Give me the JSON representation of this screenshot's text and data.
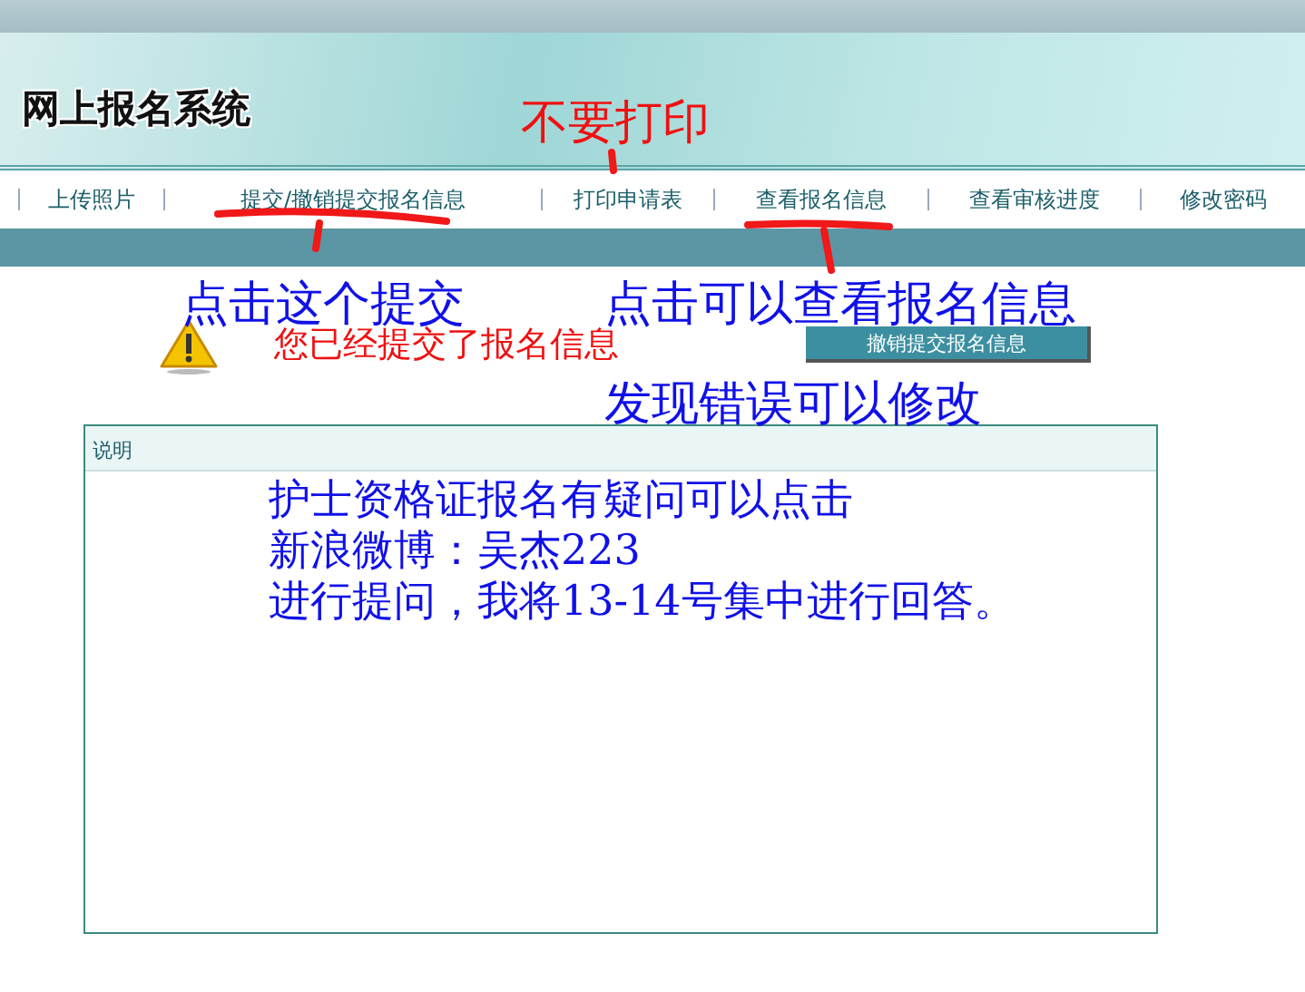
{
  "header": {
    "title": "网上报名系统"
  },
  "nav": {
    "items": [
      {
        "label": "上传照片"
      },
      {
        "label": "提交/撤销提交报名信息"
      },
      {
        "label": "打印申请表"
      },
      {
        "label": "查看报名信息"
      },
      {
        "label": "查看审核进度"
      },
      {
        "label": "修改密码"
      }
    ]
  },
  "status": {
    "message": "您已经提交了报名信息",
    "button": "撤销提交报名信息"
  },
  "panel": {
    "title": "说明"
  },
  "annotations": [
    {
      "kind": "red",
      "text": "不要打印"
    },
    {
      "kind": "blue",
      "text": "点击这个提交"
    },
    {
      "kind": "blue",
      "text": "点击可以查看报名信息"
    },
    {
      "kind": "blue",
      "text": "发现错误可以修改"
    },
    {
      "kind": "note",
      "lines": [
        "护士资格证报名有疑问可以点击",
        "新浪微博：吴杰223",
        "进行提问，我将13-14号集中进行回答。"
      ]
    }
  ]
}
